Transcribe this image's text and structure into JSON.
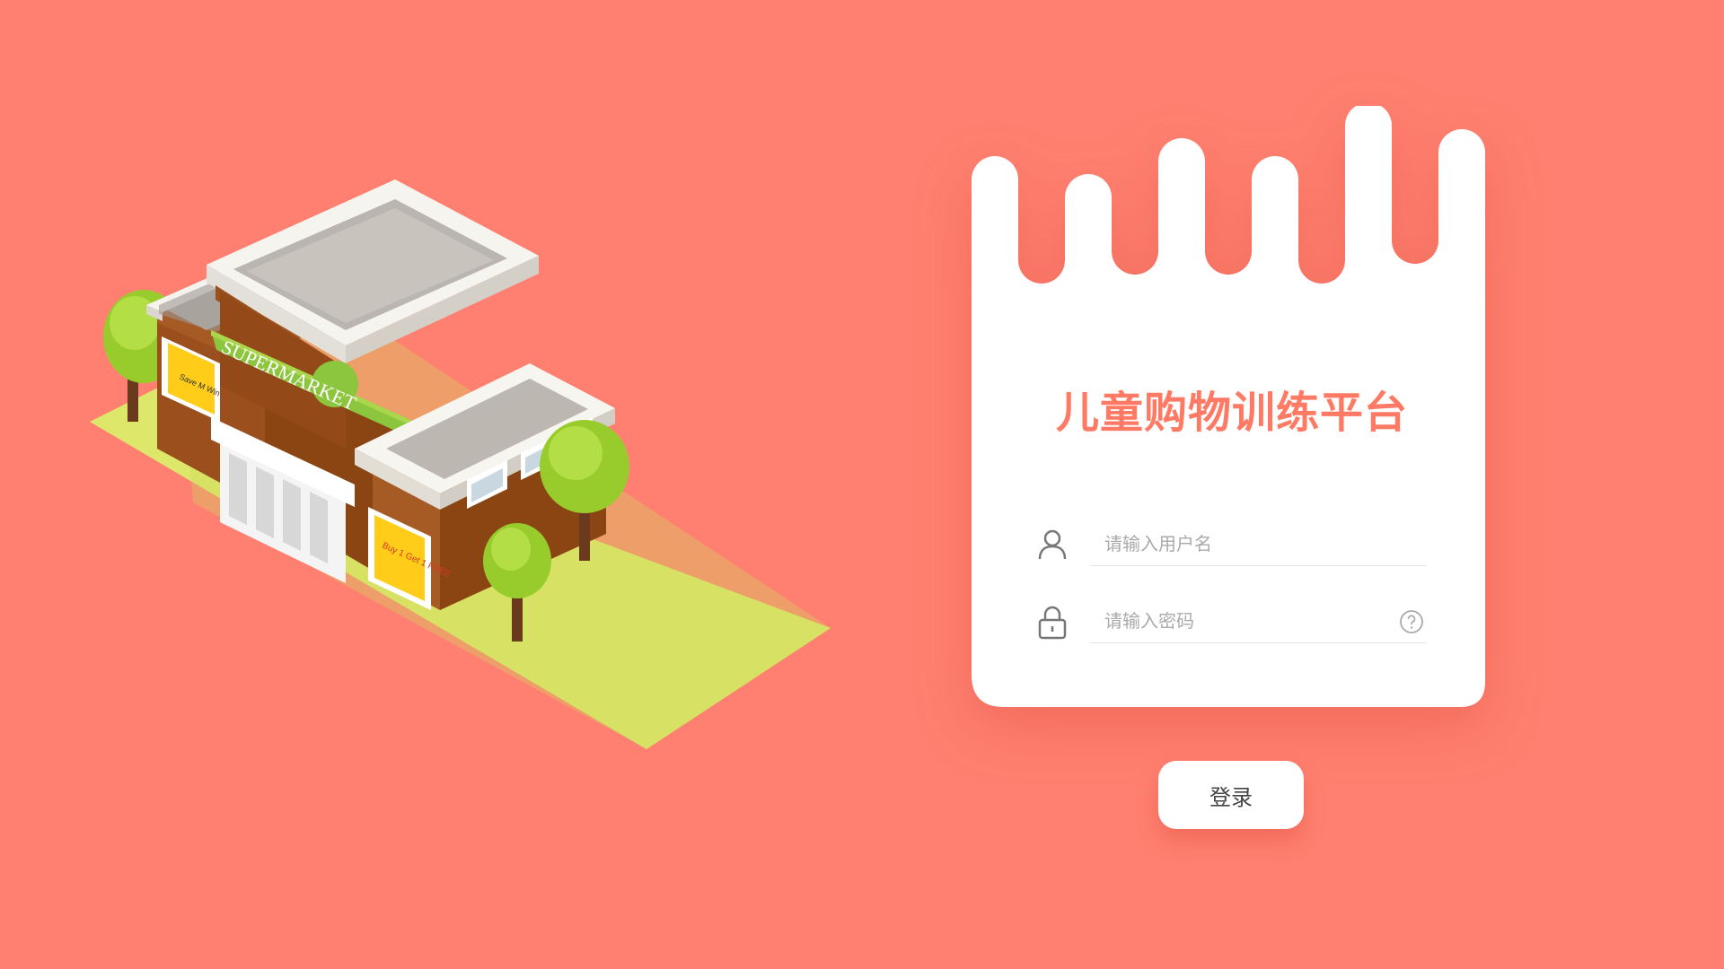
{
  "colors": {
    "background": "#FF8070",
    "accent": "#FF7A65",
    "card": "#FFFFFF"
  },
  "illustration": {
    "sign_text": "SUPERMARKET",
    "poster_left_text": "Save M Win",
    "poster_right_text": "Buy 1 Get 1 FREE"
  },
  "login": {
    "title": "儿童购物训练平台",
    "username_placeholder": "请输入用户名",
    "password_placeholder": "请输入密码",
    "submit_label": "登录"
  },
  "icons": {
    "username": "user-icon",
    "password": "lock-icon",
    "help": "question-circle-icon"
  }
}
